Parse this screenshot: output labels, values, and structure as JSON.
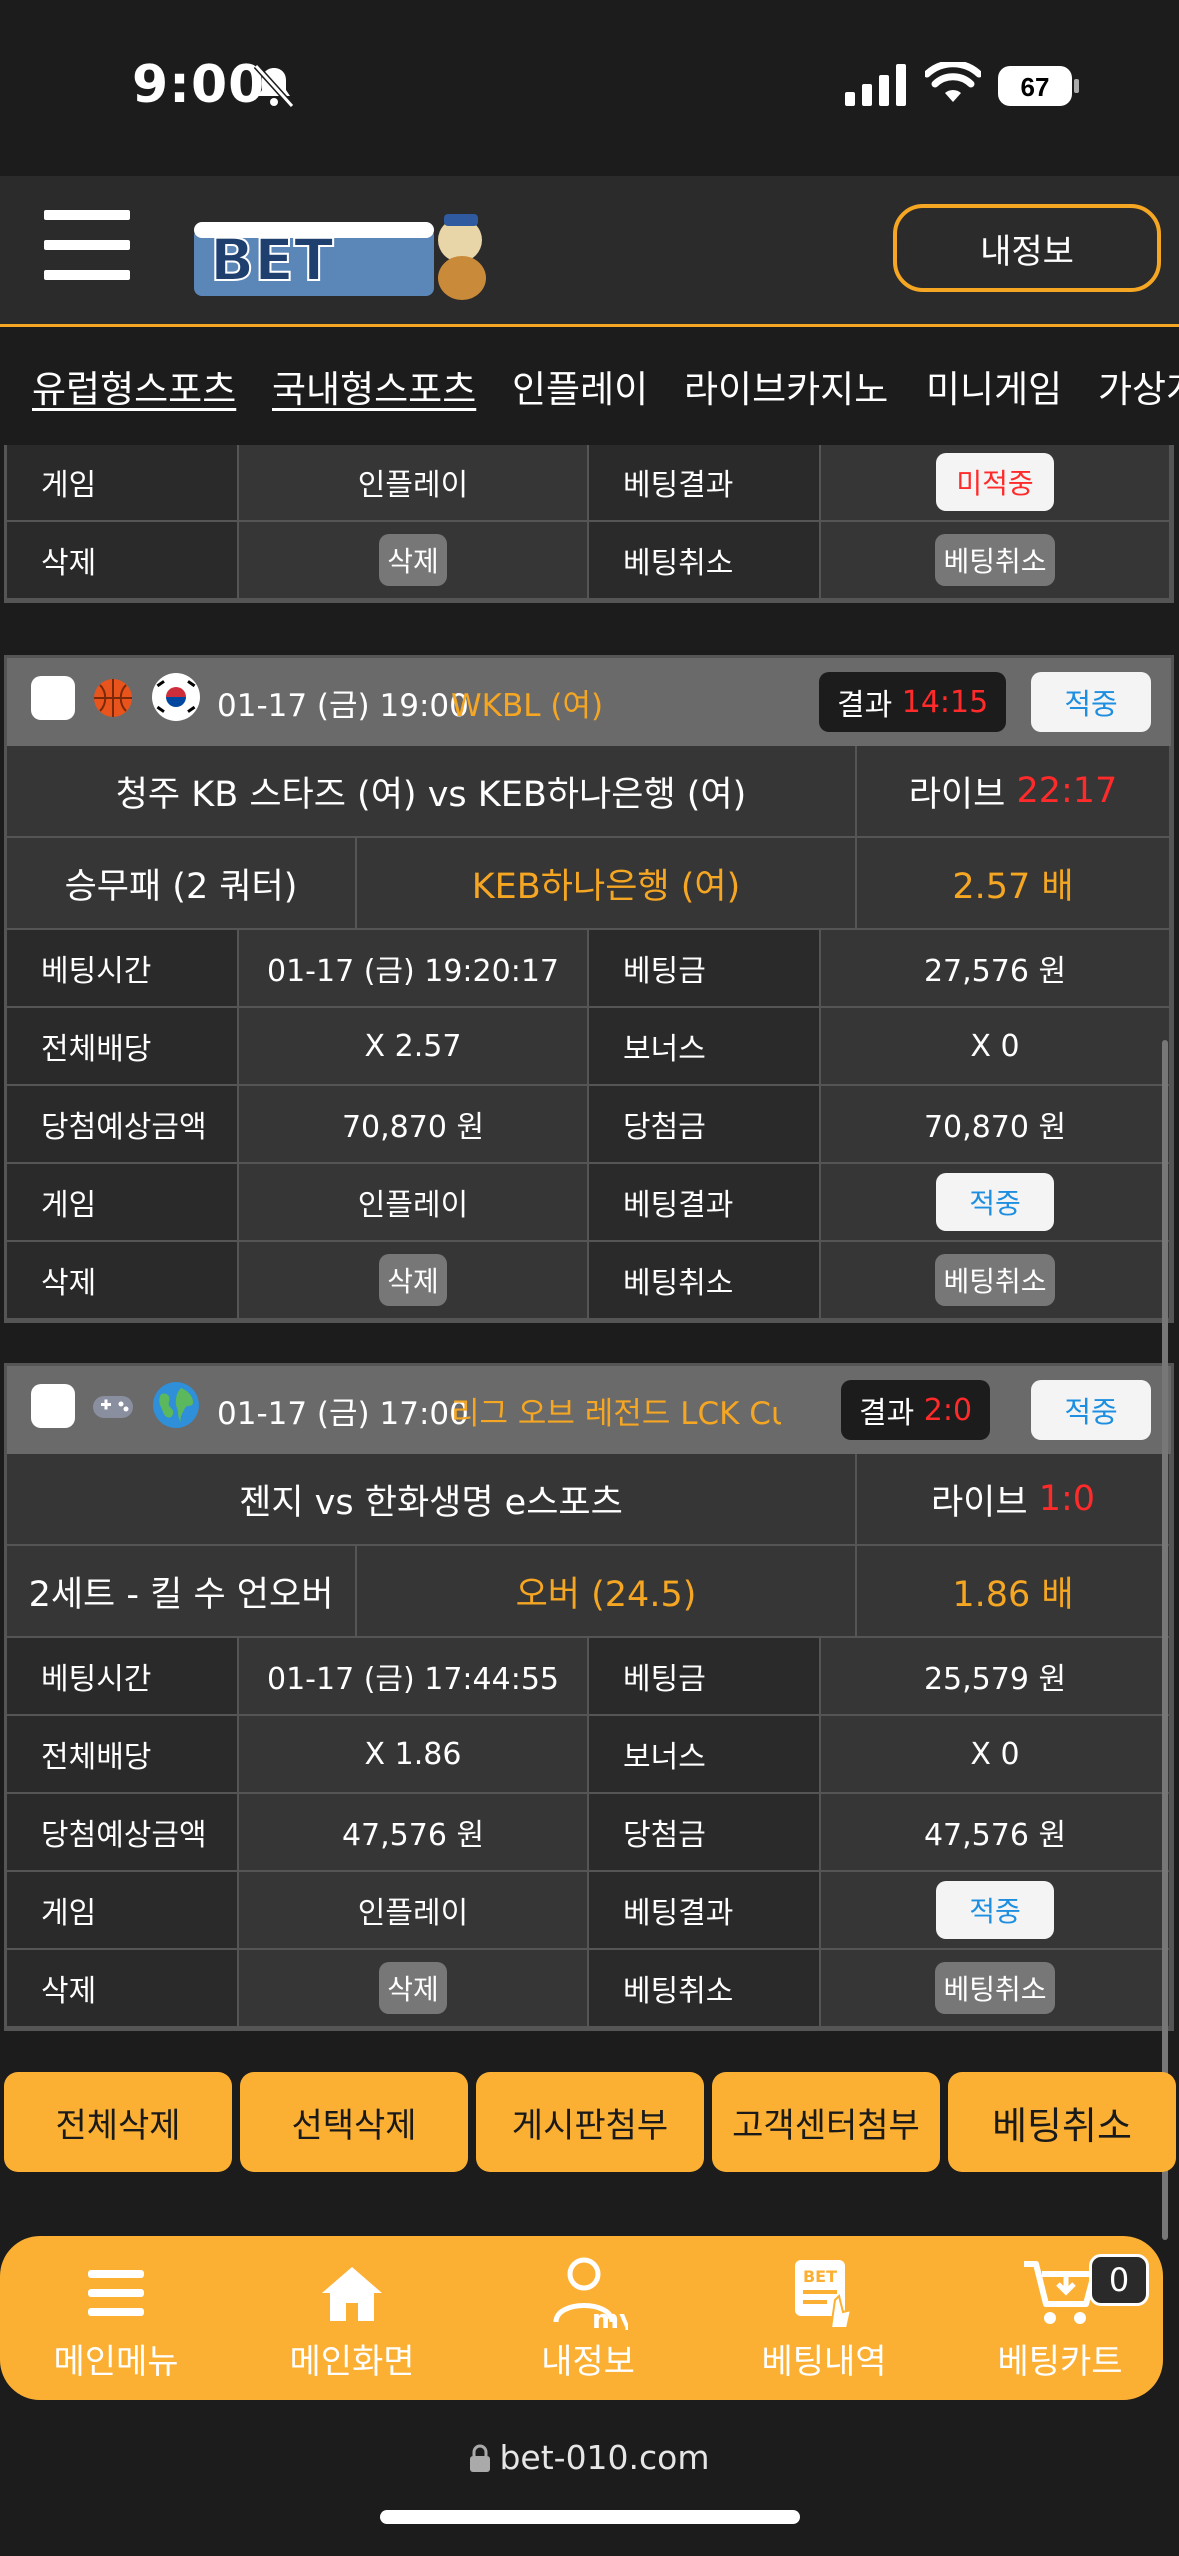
{
  "status_bar": {
    "time": "9:00",
    "battery": "67"
  },
  "header": {
    "logo_alt": "BET",
    "myinfo_label": "내정보"
  },
  "nav": {
    "items": [
      "유럽형스포츠",
      "국내형스포츠",
      "인플레이",
      "라이브카지노",
      "미니게임",
      "가상게"
    ]
  },
  "partial_card": {
    "rows": [
      {
        "l1": "게임",
        "v1": "인플레이",
        "l2": "베팅결과",
        "v2": "미적중"
      },
      {
        "l1": "삭제",
        "v1": "삭제",
        "l2": "베팅취소",
        "v2": "베팅취소"
      }
    ]
  },
  "cards": [
    {
      "datetime": "01-17 (금) 19:00",
      "league": "WKBL (여)",
      "result_label": "결과",
      "result_value": "14:15",
      "status": "적중",
      "match": "청주 KB 스타즈 (여)  vs  KEB하나은행 (여)",
      "live_label": "라이브",
      "live_value": "22:17",
      "market": "승무패 (2 쿼터)",
      "pick": "KEB하나은행 (여)",
      "odds": "2.57 배",
      "rows": [
        {
          "l1": "베팅시간",
          "v1": "01-17 (금) 19:20:17",
          "l2": "베팅금",
          "v2": "27,576 원"
        },
        {
          "l1": "전체배당",
          "v1": "X 2.57",
          "l2": "보너스",
          "v2": "X 0"
        },
        {
          "l1": "당첨예상금액",
          "v1": "70,870 원",
          "l2": "당첨금",
          "v2": "70,870 원"
        },
        {
          "l1": "게임",
          "v1": "인플레이",
          "l2": "베팅결과",
          "v2": "적중"
        },
        {
          "l1": "삭제",
          "v1": "삭제",
          "l2": "베팅취소",
          "v2": "베팅취소"
        }
      ]
    },
    {
      "datetime": "01-17 (금) 17:00",
      "league": "리그 오브 레전드 LCK Cu",
      "result_label": "결과",
      "result_value": "2:0",
      "status": "적중",
      "match": "젠지  vs  한화생명 e스포츠",
      "live_label": "라이브",
      "live_value": "1:0",
      "market": "2세트 - 킬 수 언오버",
      "pick": "오버 (24.5)",
      "odds": "1.86 배",
      "rows": [
        {
          "l1": "베팅시간",
          "v1": "01-17 (금) 17:44:55",
          "l2": "베팅금",
          "v2": "25,579 원"
        },
        {
          "l1": "전체배당",
          "v1": "X 1.86",
          "l2": "보너스",
          "v2": "X 0"
        },
        {
          "l1": "당첨예상금액",
          "v1": "47,576 원",
          "l2": "당첨금",
          "v2": "47,576 원"
        },
        {
          "l1": "게임",
          "v1": "인플레이",
          "l2": "베팅결과",
          "v2": "적중"
        },
        {
          "l1": "삭제",
          "v1": "삭제",
          "l2": "베팅취소",
          "v2": "베팅취소"
        }
      ]
    }
  ],
  "actions": [
    "전체삭제",
    "선택삭제",
    "게시판첨부",
    "고객센터첨부",
    "베팅취소"
  ],
  "tabbar": {
    "items": [
      "메인메뉴",
      "메인화면",
      "내정보",
      "베팅내역",
      "베팅카트"
    ],
    "my_label": "my",
    "bet_label": "BET",
    "cart_count": "0"
  },
  "url": "bet-010.com",
  "colors": {
    "accent": "#f5a623",
    "button": "#fbb033",
    "win": "#1e8fe0",
    "loss": "#ff2a2a"
  }
}
